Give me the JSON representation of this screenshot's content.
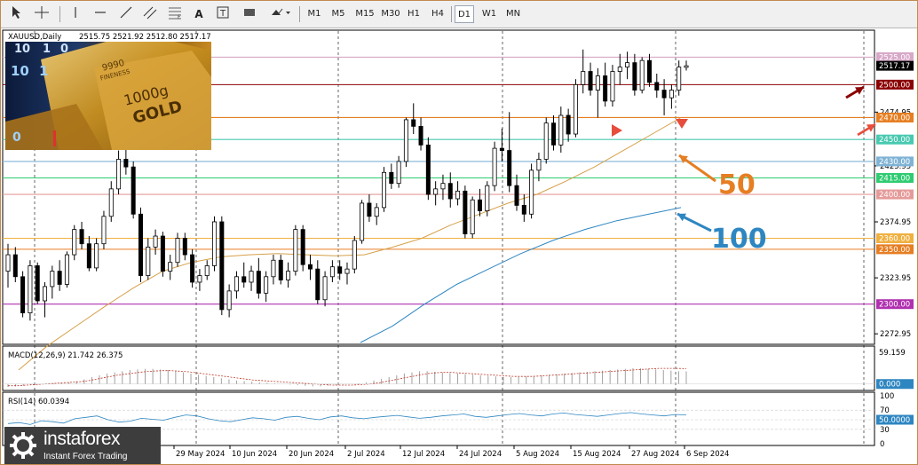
{
  "toolbar": {
    "timeframes": [
      "M1",
      "M5",
      "M15",
      "M30",
      "H1",
      "H4",
      "D1",
      "W1",
      "MN"
    ],
    "active_timeframe": "D1",
    "tools": [
      "cursor-icon",
      "crosshair-icon",
      "vertical-line-icon",
      "horizontal-line-icon",
      "trendline-icon",
      "channel-icon",
      "fibonacci-icon",
      "text-icon",
      "text-label-icon",
      "rectangle-icon",
      "shapes-dropdown-icon"
    ]
  },
  "header": {
    "symbol": "XAUUSD,Daily",
    "ohlc": "2515.75 2521.92 2512.80 2517.17"
  },
  "image": {
    "lines": [
      "9990",
      "FINENESS",
      "1000g",
      "GOLD"
    ],
    "digits": [
      "10",
      "1",
      "0",
      "10",
      "1",
      "0"
    ]
  },
  "annotations": {
    "ma50": "50",
    "ma100": "100"
  },
  "colors": {
    "ma50": "#d6a04a",
    "ma100": "#2e86c1",
    "ma50_label": "#e67e22",
    "ma100_label": "#2e86c1",
    "arrow_dark": "#8b0000",
    "arrow_red": "#e74c3c",
    "price_box": "#000000"
  },
  "watermark": {
    "brand": "instaforex",
    "tagline": "Instant Forex Trading"
  },
  "chart_data": [
    {
      "type": "candlestick",
      "title": "XAUUSD,Daily",
      "ylim": [
        2265,
        2548
      ],
      "y_ticks": [
        "2474.95",
        "2425.95",
        "2374.95",
        "2323.95",
        "2272.95"
      ],
      "x_labels": [
        "29 May 2024",
        "10 Jun 2024",
        "20 Jun 2024",
        "2 Jul 2024",
        "12 Jul 2024",
        "24 Jul 2024",
        "5 Aug 2024",
        "15 Aug 2024",
        "27 Aug 2024",
        "6 Sep 2024"
      ],
      "last_price": "2517.17",
      "levels": [
        {
          "value": 2525,
          "label": "2525.00",
          "color": "#d8a8c8"
        },
        {
          "value": 2500,
          "label": "2500.00",
          "color": "#8b0000"
        },
        {
          "value": 2470,
          "label": "2470.00",
          "color": "#e67e22"
        },
        {
          "value": 2450,
          "label": "2450.00",
          "color": "#48c9b0"
        },
        {
          "value": 2430,
          "label": "2430.00",
          "color": "#7fb3d5"
        },
        {
          "value": 2415,
          "label": "2415.00",
          "color": "#2ecc71"
        },
        {
          "value": 2400,
          "label": "2400.00",
          "color": "#e59a9a"
        },
        {
          "value": 2360,
          "label": "2360.00",
          "color": "#f0b040"
        },
        {
          "value": 2350,
          "label": "2350.00",
          "color": "#e67e22"
        },
        {
          "value": 2300,
          "label": "2300.00",
          "color": "#b030b0"
        }
      ],
      "candles": [
        {
          "o": 2330,
          "h": 2355,
          "l": 2315,
          "c": 2345
        },
        {
          "o": 2345,
          "h": 2352,
          "l": 2320,
          "c": 2325
        },
        {
          "o": 2325,
          "h": 2330,
          "l": 2288,
          "c": 2292
        },
        {
          "o": 2292,
          "h": 2340,
          "l": 2285,
          "c": 2335
        },
        {
          "o": 2335,
          "h": 2338,
          "l": 2300,
          "c": 2303
        },
        {
          "o": 2303,
          "h": 2320,
          "l": 2288,
          "c": 2316
        },
        {
          "o": 2316,
          "h": 2335,
          "l": 2305,
          "c": 2330
        },
        {
          "o": 2330,
          "h": 2340,
          "l": 2312,
          "c": 2318
        },
        {
          "o": 2318,
          "h": 2348,
          "l": 2315,
          "c": 2345
        },
        {
          "o": 2345,
          "h": 2372,
          "l": 2340,
          "c": 2368
        },
        {
          "o": 2368,
          "h": 2375,
          "l": 2350,
          "c": 2355
        },
        {
          "o": 2355,
          "h": 2362,
          "l": 2330,
          "c": 2333
        },
        {
          "o": 2333,
          "h": 2360,
          "l": 2330,
          "c": 2355
        },
        {
          "o": 2355,
          "h": 2385,
          "l": 2350,
          "c": 2380
        },
        {
          "o": 2380,
          "h": 2412,
          "l": 2375,
          "c": 2405
        },
        {
          "o": 2405,
          "h": 2440,
          "l": 2400,
          "c": 2432
        },
        {
          "o": 2432,
          "h": 2445,
          "l": 2418,
          "c": 2425
        },
        {
          "o": 2425,
          "h": 2430,
          "l": 2378,
          "c": 2382
        },
        {
          "o": 2382,
          "h": 2388,
          "l": 2320,
          "c": 2326
        },
        {
          "o": 2326,
          "h": 2360,
          "l": 2322,
          "c": 2352
        },
        {
          "o": 2352,
          "h": 2368,
          "l": 2345,
          "c": 2362
        },
        {
          "o": 2362,
          "h": 2366,
          "l": 2325,
          "c": 2330
        },
        {
          "o": 2330,
          "h": 2345,
          "l": 2322,
          "c": 2338
        },
        {
          "o": 2338,
          "h": 2365,
          "l": 2334,
          "c": 2360
        },
        {
          "o": 2360,
          "h": 2365,
          "l": 2340,
          "c": 2345
        },
        {
          "o": 2345,
          "h": 2350,
          "l": 2315,
          "c": 2320
        },
        {
          "o": 2320,
          "h": 2332,
          "l": 2312,
          "c": 2326
        },
        {
          "o": 2326,
          "h": 2340,
          "l": 2322,
          "c": 2335
        },
        {
          "o": 2335,
          "h": 2380,
          "l": 2330,
          "c": 2375
        },
        {
          "o": 2375,
          "h": 2380,
          "l": 2290,
          "c": 2295
        },
        {
          "o": 2295,
          "h": 2318,
          "l": 2288,
          "c": 2312
        },
        {
          "o": 2312,
          "h": 2330,
          "l": 2305,
          "c": 2325
        },
        {
          "o": 2325,
          "h": 2338,
          "l": 2315,
          "c": 2320
        },
        {
          "o": 2320,
          "h": 2335,
          "l": 2312,
          "c": 2330
        },
        {
          "o": 2330,
          "h": 2342,
          "l": 2305,
          "c": 2310
        },
        {
          "o": 2310,
          "h": 2330,
          "l": 2302,
          "c": 2325
        },
        {
          "o": 2325,
          "h": 2345,
          "l": 2318,
          "c": 2340
        },
        {
          "o": 2340,
          "h": 2345,
          "l": 2318,
          "c": 2322
        },
        {
          "o": 2322,
          "h": 2338,
          "l": 2315,
          "c": 2330
        },
        {
          "o": 2330,
          "h": 2372,
          "l": 2326,
          "c": 2368
        },
        {
          "o": 2368,
          "h": 2372,
          "l": 2330,
          "c": 2336
        },
        {
          "o": 2336,
          "h": 2345,
          "l": 2322,
          "c": 2332
        },
        {
          "o": 2332,
          "h": 2340,
          "l": 2300,
          "c": 2304
        },
        {
          "o": 2304,
          "h": 2330,
          "l": 2298,
          "c": 2325
        },
        {
          "o": 2325,
          "h": 2340,
          "l": 2320,
          "c": 2334
        },
        {
          "o": 2334,
          "h": 2340,
          "l": 2322,
          "c": 2328
        },
        {
          "o": 2328,
          "h": 2338,
          "l": 2318,
          "c": 2332
        },
        {
          "o": 2332,
          "h": 2362,
          "l": 2328,
          "c": 2358
        },
        {
          "o": 2358,
          "h": 2395,
          "l": 2355,
          "c": 2392
        },
        {
          "o": 2392,
          "h": 2400,
          "l": 2375,
          "c": 2380
        },
        {
          "o": 2380,
          "h": 2392,
          "l": 2372,
          "c": 2388
        },
        {
          "o": 2388,
          "h": 2425,
          "l": 2384,
          "c": 2420
        },
        {
          "o": 2420,
          "h": 2428,
          "l": 2405,
          "c": 2410
        },
        {
          "o": 2410,
          "h": 2435,
          "l": 2406,
          "c": 2430
        },
        {
          "o": 2430,
          "h": 2470,
          "l": 2425,
          "c": 2468
        },
        {
          "o": 2468,
          "h": 2483,
          "l": 2455,
          "c": 2462
        },
        {
          "o": 2462,
          "h": 2470,
          "l": 2440,
          "c": 2445
        },
        {
          "o": 2445,
          "h": 2452,
          "l": 2395,
          "c": 2400
        },
        {
          "o": 2400,
          "h": 2412,
          "l": 2390,
          "c": 2405
        },
        {
          "o": 2405,
          "h": 2418,
          "l": 2395,
          "c": 2410
        },
        {
          "o": 2410,
          "h": 2420,
          "l": 2388,
          "c": 2396
        },
        {
          "o": 2396,
          "h": 2412,
          "l": 2390,
          "c": 2403
        },
        {
          "o": 2403,
          "h": 2408,
          "l": 2360,
          "c": 2364
        },
        {
          "o": 2364,
          "h": 2398,
          "l": 2360,
          "c": 2395
        },
        {
          "o": 2395,
          "h": 2405,
          "l": 2380,
          "c": 2385
        },
        {
          "o": 2385,
          "h": 2412,
          "l": 2380,
          "c": 2408
        },
        {
          "o": 2408,
          "h": 2448,
          "l": 2403,
          "c": 2442
        },
        {
          "o": 2442,
          "h": 2460,
          "l": 2430,
          "c": 2440
        },
        {
          "o": 2440,
          "h": 2475,
          "l": 2402,
          "c": 2408
        },
        {
          "o": 2408,
          "h": 2418,
          "l": 2385,
          "c": 2390
        },
        {
          "o": 2390,
          "h": 2400,
          "l": 2375,
          "c": 2382
        },
        {
          "o": 2382,
          "h": 2428,
          "l": 2378,
          "c": 2422
        },
        {
          "o": 2422,
          "h": 2438,
          "l": 2412,
          "c": 2432
        },
        {
          "o": 2432,
          "h": 2470,
          "l": 2428,
          "c": 2465
        },
        {
          "o": 2465,
          "h": 2472,
          "l": 2440,
          "c": 2445
        },
        {
          "o": 2445,
          "h": 2480,
          "l": 2438,
          "c": 2472
        },
        {
          "o": 2472,
          "h": 2478,
          "l": 2448,
          "c": 2455
        },
        {
          "o": 2455,
          "h": 2505,
          "l": 2452,
          "c": 2500
        },
        {
          "o": 2500,
          "h": 2532,
          "l": 2492,
          "c": 2512
        },
        {
          "o": 2512,
          "h": 2520,
          "l": 2490,
          "c": 2495
        },
        {
          "o": 2495,
          "h": 2515,
          "l": 2470,
          "c": 2508
        },
        {
          "o": 2508,
          "h": 2520,
          "l": 2480,
          "c": 2485
        },
        {
          "o": 2485,
          "h": 2518,
          "l": 2480,
          "c": 2512
        },
        {
          "o": 2512,
          "h": 2528,
          "l": 2500,
          "c": 2516
        },
        {
          "o": 2516,
          "h": 2530,
          "l": 2505,
          "c": 2520
        },
        {
          "o": 2520,
          "h": 2528,
          "l": 2490,
          "c": 2495
        },
        {
          "o": 2495,
          "h": 2525,
          "l": 2492,
          "c": 2522
        },
        {
          "o": 2522,
          "h": 2528,
          "l": 2498,
          "c": 2502
        },
        {
          "o": 2502,
          "h": 2510,
          "l": 2488,
          "c": 2495
        },
        {
          "o": 2495,
          "h": 2505,
          "l": 2472,
          "c": 2488
        },
        {
          "o": 2488,
          "h": 2500,
          "l": 2478,
          "c": 2495
        },
        {
          "o": 2495,
          "h": 2522,
          "l": 2490,
          "c": 2516
        },
        {
          "o": 2515.75,
          "h": 2521.92,
          "l": 2512.8,
          "c": 2517.17
        }
      ],
      "series": [
        {
          "name": "50",
          "values": [
            2240,
            2262,
            2280,
            2298,
            2315,
            2330,
            2338,
            2343,
            2345,
            2346,
            2345,
            2344,
            2345,
            2352,
            2360,
            2372,
            2382,
            2392,
            2400,
            2412,
            2425,
            2440,
            2455,
            2470
          ]
        },
        {
          "name": "100",
          "values": [
            2265,
            2280,
            2300,
            2318,
            2332,
            2346,
            2358,
            2368,
            2376,
            2382,
            2388
          ]
        }
      ]
    },
    {
      "type": "histogram",
      "title": "MACD(12,26,9) 21.742 26.375",
      "y_ticks": [
        "59.159",
        "0.000"
      ],
      "ylim": [
        -5,
        59.159
      ],
      "histogram": [
        -5,
        -4,
        -3,
        -2,
        -1,
        0,
        1,
        2,
        3,
        5,
        8,
        12,
        15,
        18,
        20,
        22,
        24,
        25,
        26,
        26,
        25,
        24,
        22,
        20,
        18,
        16,
        14,
        12,
        10,
        8,
        6,
        5,
        4,
        3,
        2,
        1,
        0,
        -1,
        -2,
        -3,
        -4,
        -4,
        -3,
        -2,
        -1,
        0,
        1,
        3,
        6,
        9,
        12,
        15,
        18,
        20,
        22,
        22,
        21,
        20,
        19,
        18,
        17,
        16,
        15,
        14,
        13,
        12,
        12,
        12,
        13,
        14,
        15,
        16,
        17,
        18,
        19,
        20,
        21,
        22,
        23,
        24,
        25,
        26,
        27,
        27,
        26,
        25,
        24,
        23,
        22,
        21.742
      ],
      "signal": [
        -3,
        -3,
        -2,
        -1,
        0,
        1,
        2,
        3,
        4,
        6,
        9,
        12,
        15,
        17,
        19,
        21,
        22,
        23,
        23,
        22,
        21,
        19,
        17,
        15,
        13,
        11,
        9,
        7,
        6,
        5,
        4,
        3,
        2,
        1,
        0,
        -1,
        -2,
        -2,
        -2,
        -1,
        0,
        2,
        5,
        8,
        11,
        14,
        17,
        19,
        20,
        20,
        19,
        18,
        17,
        16,
        15,
        14,
        13,
        13,
        13,
        14,
        15,
        16,
        17,
        18,
        19,
        20,
        21,
        22,
        23,
        24,
        25,
        26,
        27,
        27,
        27,
        26.375
      ]
    },
    {
      "type": "line",
      "title": "RSI(14) 60.0394",
      "y_ticks": [
        "100",
        "70",
        "50.0000",
        "30",
        "0"
      ],
      "ylim": [
        0,
        100
      ],
      "values": [
        42,
        44,
        40,
        48,
        46,
        43,
        52,
        55,
        58,
        50,
        45,
        47,
        53,
        51,
        49,
        55,
        60,
        58,
        52,
        48,
        46,
        50,
        54,
        52,
        49,
        55,
        57,
        53,
        50,
        56,
        58,
        54,
        52,
        55,
        57,
        59,
        56,
        53,
        55,
        58,
        60,
        62,
        57,
        55,
        58,
        61,
        63,
        60,
        58,
        62,
        64,
        61,
        59,
        57,
        60,
        63,
        65,
        62,
        60,
        58,
        61,
        60.0394
      ]
    }
  ]
}
